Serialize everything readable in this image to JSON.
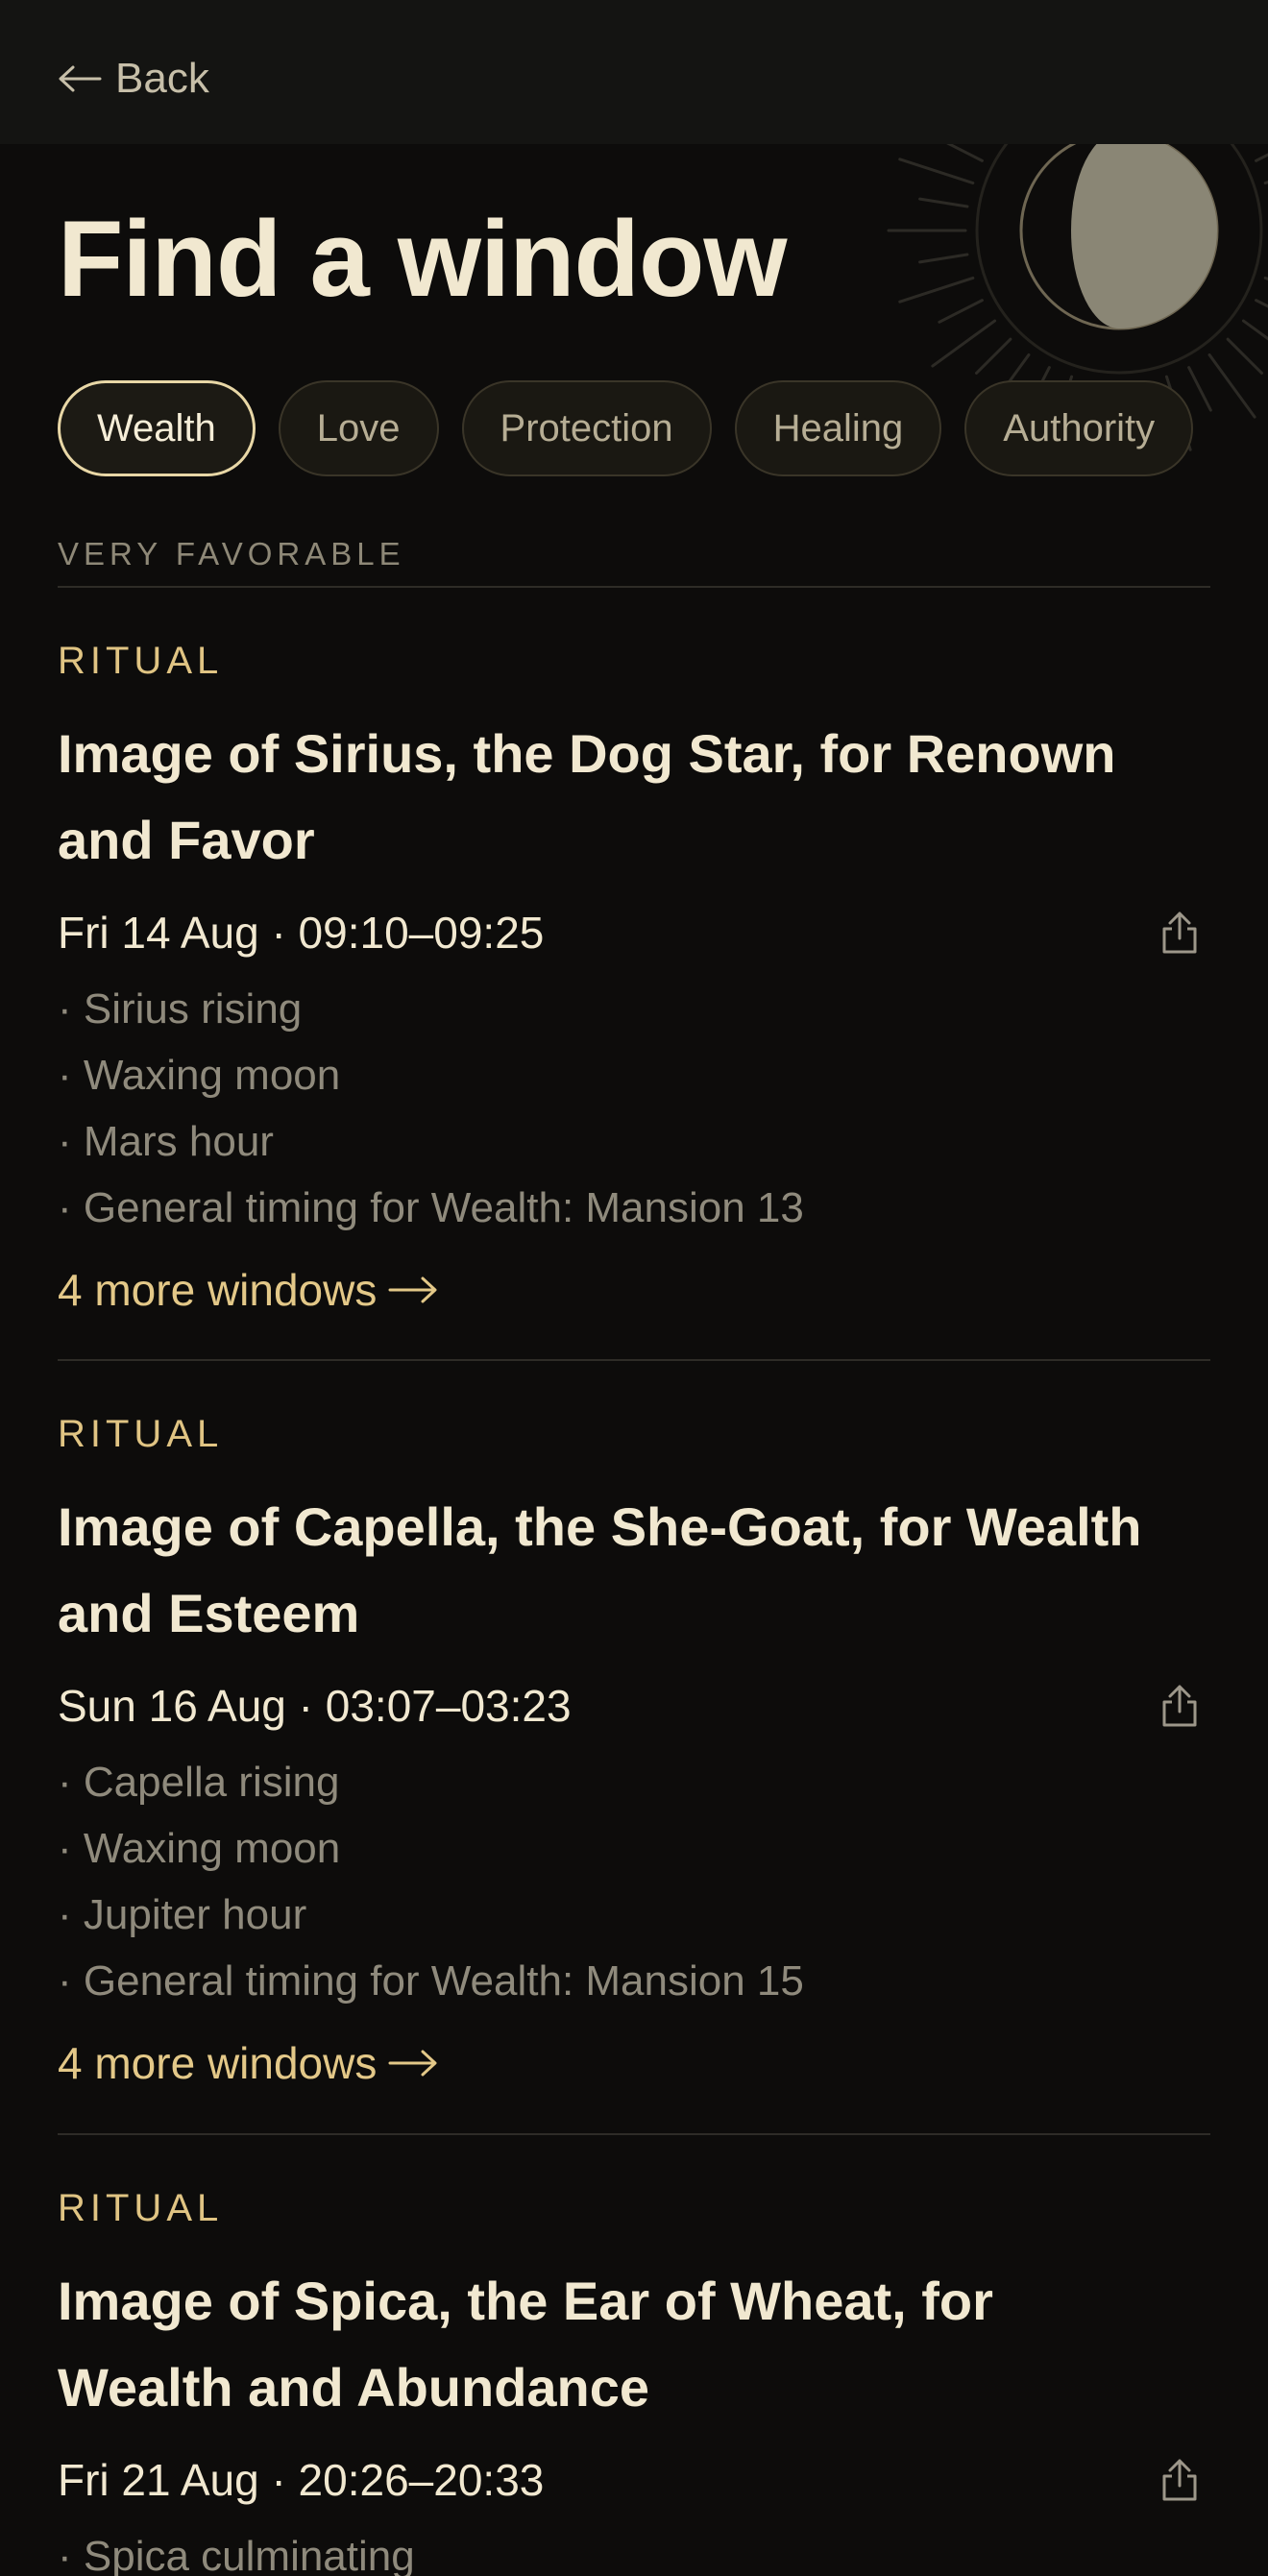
{
  "nav": {
    "back_label": "Back"
  },
  "page": {
    "title": "Find a window"
  },
  "filters": [
    {
      "label": "Wealth",
      "active": true
    },
    {
      "label": "Love",
      "active": false
    },
    {
      "label": "Protection",
      "active": false
    },
    {
      "label": "Healing",
      "active": false
    },
    {
      "label": "Authority",
      "active": false
    }
  ],
  "section": {
    "label": "VERY FAVORABLE"
  },
  "rituals": [
    {
      "kind": "RITUAL",
      "title": "Image of Sirius, the Dog Star, for Renown and Favor",
      "when": "Fri 14 Aug · 09:10–09:25",
      "reasons": [
        "· Sirius rising",
        "· Waxing moon",
        "· Mars hour",
        "· General timing for Wealth: Mansion 13"
      ],
      "more": "4 more windows"
    },
    {
      "kind": "RITUAL",
      "title": "Image of Capella, the She-Goat, for Wealth and Esteem",
      "when": "Sun 16 Aug · 03:07–03:23",
      "reasons": [
        "· Capella rising",
        "· Waxing moon",
        "· Jupiter hour",
        "· General timing for Wealth: Mansion 15"
      ],
      "more": "4 more windows"
    },
    {
      "kind": "RITUAL",
      "title": "Image of Spica, the Ear of Wheat, for Wealth and Abundance",
      "when": "Fri 21 Aug · 20:26–20:33",
      "reasons": [
        "· Spica culminating"
      ]
    }
  ],
  "colors": {
    "background": "#0d0c0b",
    "accent": "#e0c483",
    "text": "#f1e8d0",
    "muted": "#8f8a7c"
  },
  "icons": {
    "back": "arrow-left-icon",
    "share": "share-icon",
    "more": "arrow-right-icon",
    "decor": "sun-moon-icon"
  }
}
